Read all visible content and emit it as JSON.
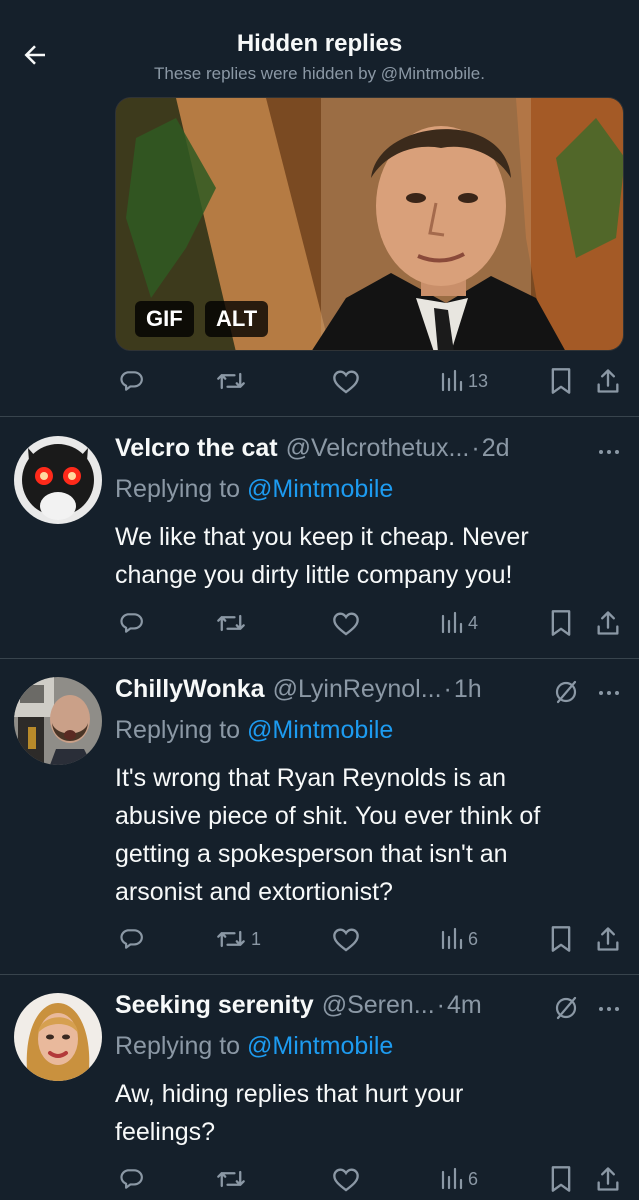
{
  "header": {
    "title": "Hidden replies",
    "subtitle": "These replies were hidden by @Mintmobile."
  },
  "media": {
    "gif_label": "GIF",
    "alt_label": "ALT"
  },
  "top_actions": {
    "views": "13"
  },
  "tweets": [
    {
      "name": "Velcro the cat",
      "handle": "@Velcrothetux...",
      "time": "2d",
      "replying_prefix": "Replying to ",
      "replying_to": "@Mintmobile",
      "lines": [
        "We like that you keep it cheap.  Never",
        "change you dirty little company you!"
      ],
      "retweets": "",
      "views": "4"
    },
    {
      "name": "ChillyWonka",
      "handle": "@LyinReynol...",
      "time": "1h",
      "replying_prefix": "Replying to ",
      "replying_to": "@Mintmobile",
      "lines": [
        "It's wrong that Ryan Reynolds is an",
        "abusive piece of shit. You ever think of",
        "getting a spokesperson that isn't an",
        "arsonist and extortionist?"
      ],
      "retweets": "1",
      "views": "6"
    },
    {
      "name": "Seeking serenity",
      "handle": "@Seren...",
      "time": "4m",
      "replying_prefix": "Replying to ",
      "replying_to": "@Mintmobile",
      "lines": [
        "Aw, hiding replies that hurt your",
        "feelings?"
      ],
      "retweets": "",
      "views": "6"
    }
  ],
  "colors": {
    "background": "#15202b",
    "text": "#f7f9f9",
    "secondary": "#8b98a5",
    "mention": "#1d9bf0",
    "divider": "#38444d"
  },
  "icons": [
    "back-arrow-icon",
    "reply-icon",
    "retweet-icon",
    "like-icon",
    "views-icon",
    "bookmark-icon",
    "share-icon",
    "hidden-reply-icon",
    "more-icon"
  ]
}
